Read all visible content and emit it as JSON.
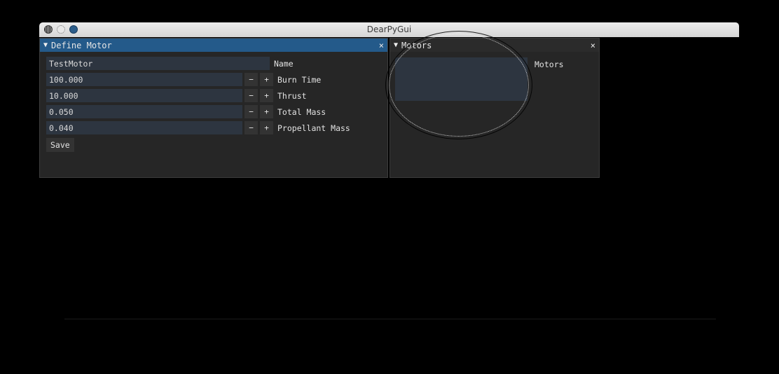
{
  "window": {
    "title": "DearPyGui"
  },
  "define_motor": {
    "title": "Define Motor",
    "close_glyph": "×",
    "name_value": "TestMotor",
    "name_label": "Name",
    "rows": [
      {
        "value": "100.000",
        "label": "Burn Time"
      },
      {
        "value": "10.000",
        "label": "Thrust"
      },
      {
        "value": "0.050",
        "label": "Total Mass"
      },
      {
        "value": "0.040",
        "label": "Propellant Mass"
      }
    ],
    "minus_glyph": "−",
    "plus_glyph": "+",
    "save_label": "Save"
  },
  "motors": {
    "title": "Motors",
    "close_glyph": "×",
    "list_label": "Motors",
    "items": []
  },
  "colors": {
    "active_header": "#245a8a",
    "panel_bg": "#262626",
    "field_bg": "#2d3540"
  },
  "icons": {
    "collapse": "triangle-down-icon",
    "close": "close-icon"
  }
}
